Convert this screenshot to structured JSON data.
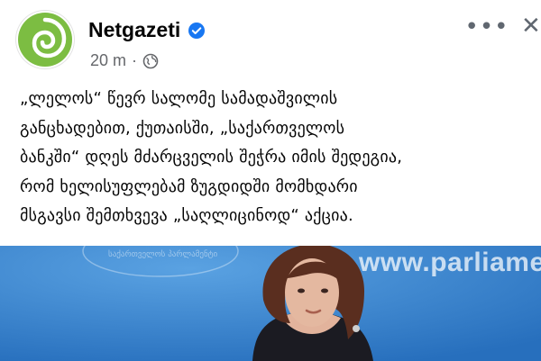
{
  "post": {
    "page_name": "Netgazeti",
    "time_ago": "20 m",
    "separator": "·",
    "text": "„ლელოს“ წევრ სალომე სამადაშვილის\nგანცხადებით, ქუთაისში, „საქართველოს\nბანკში“ დღეს მძარცველის შეჭრა იმის შედეგია,\nრომ ხელისუფლებამ ზუგდიდში მომხდარი\nმსგავსი შემთხვევა „საღლიცინოდ“ აქცია."
  },
  "actions": {
    "more_label": "•••",
    "close_label": "✕"
  },
  "image": {
    "watermark_url": "www.parliament.ge",
    "background_color": "#2f7fcc"
  },
  "icons": {
    "avatar": "netgazeti-spiral-logo",
    "verified": "verified-badge-icon",
    "privacy": "globe-icon",
    "more": "more-icon",
    "close": "close-icon"
  },
  "colors": {
    "brand_green": "#6fb43f",
    "verified_blue": "#1877f2",
    "meta_gray": "#65676b"
  }
}
